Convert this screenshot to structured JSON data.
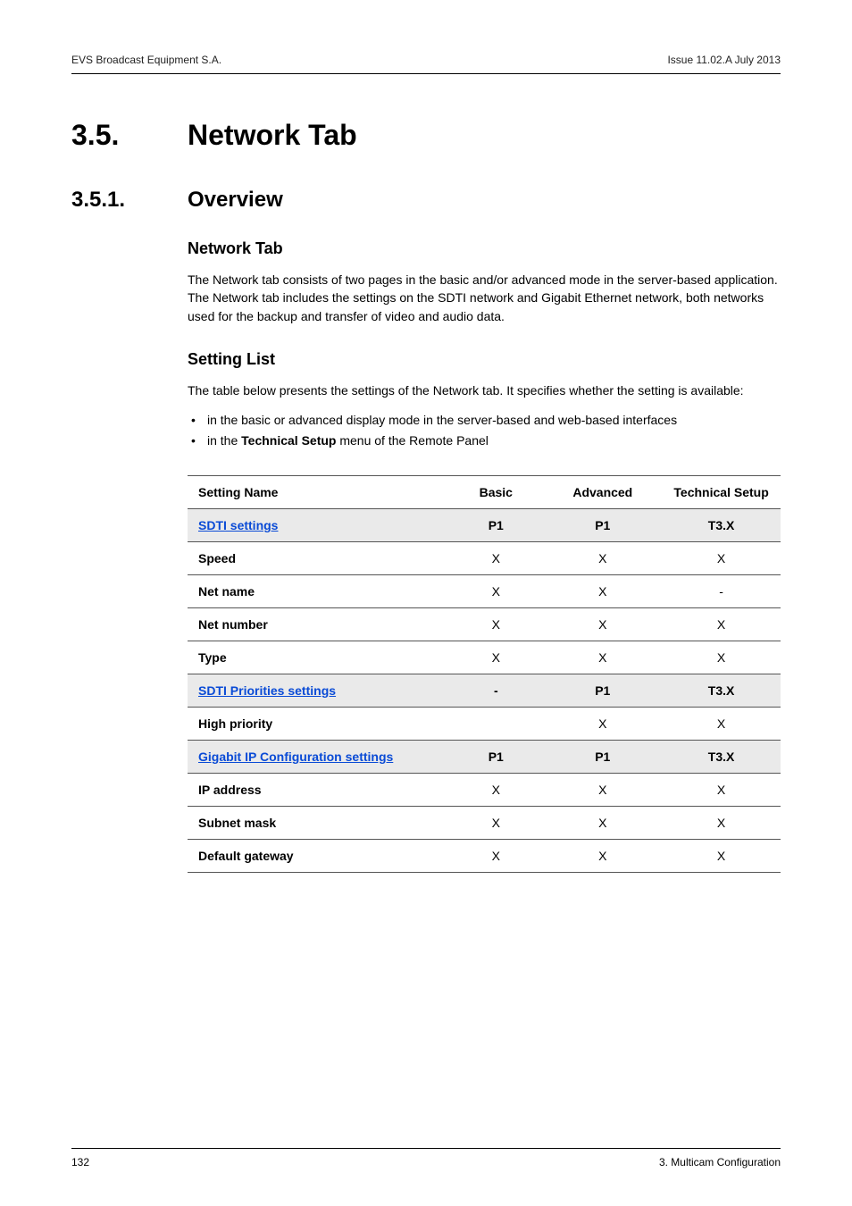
{
  "meta": {
    "left_header": "EVS Broadcast Equipment S.A.",
    "right_header": "Issue 11.02.A  July 2013",
    "page_number": "132",
    "footer_right": "3. Multicam Configuration"
  },
  "section": {
    "num": "3.5.",
    "title": "Network Tab"
  },
  "subsection": {
    "num": "3.5.1.",
    "title": "Overview"
  },
  "block1": {
    "heading": "Network Tab",
    "para": "The Network tab consists of two pages in the basic and/or advanced mode in the server-based application. The Network tab includes the settings on the SDTI network and Gigabit Ethernet network, both networks used for the backup and transfer of video and audio data."
  },
  "block2": {
    "heading": "Setting List",
    "para": "The table below presents the settings of the Network tab. It specifies whether the setting is available:",
    "bullets": [
      "in the basic or advanced display mode in the server-based and web-based interfaces",
      "in the  menu of the Remote Panel"
    ],
    "bullet2_bold": "Technical Setup"
  },
  "table": {
    "headers": {
      "name": "Setting Name",
      "basic": "Basic",
      "advanced": "Advanced",
      "tech": "Technical Setup"
    },
    "rows": [
      {
        "name": "SDTI settings",
        "link": true,
        "basic": "P1",
        "advanced": "P1",
        "tech": "T3.X",
        "section": true
      },
      {
        "name": "Speed",
        "link": false,
        "basic": "X",
        "advanced": "X",
        "tech": "X",
        "section": false
      },
      {
        "name": "Net name",
        "link": false,
        "basic": "X",
        "advanced": "X",
        "tech": "-",
        "section": false
      },
      {
        "name": "Net number",
        "link": false,
        "basic": "X",
        "advanced": "X",
        "tech": "X",
        "section": false
      },
      {
        "name": "Type",
        "link": false,
        "basic": "X",
        "advanced": "X",
        "tech": "X",
        "section": false
      },
      {
        "name": "SDTI Priorities settings",
        "link": true,
        "basic": "-",
        "advanced": "P1",
        "tech": "T3.X",
        "section": true
      },
      {
        "name": "High priority",
        "link": false,
        "basic": "",
        "advanced": "X",
        "tech": "X",
        "section": false
      },
      {
        "name": "Gigabit IP Configuration settings",
        "link": true,
        "basic": "P1",
        "advanced": "P1",
        "tech": "T3.X",
        "section": true
      },
      {
        "name": "IP address",
        "link": false,
        "basic": "X",
        "advanced": "X",
        "tech": "X",
        "section": false
      },
      {
        "name": "Subnet mask",
        "link": false,
        "basic": "X",
        "advanced": "X",
        "tech": "X",
        "section": false
      },
      {
        "name": "Default gateway",
        "link": false,
        "basic": "X",
        "advanced": "X",
        "tech": "X",
        "section": false
      }
    ]
  }
}
